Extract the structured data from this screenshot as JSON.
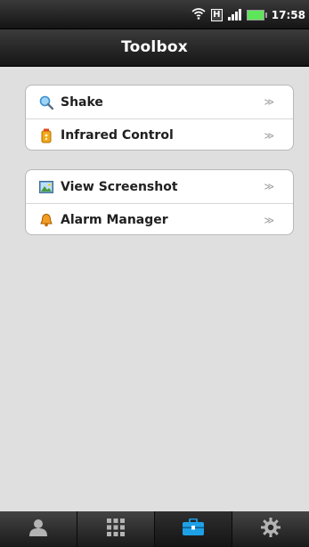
{
  "status_bar": {
    "network_badge": "H",
    "time": "17:58",
    "icons": [
      "wifi-icon",
      "network-h-icon",
      "signal-icon",
      "battery-icon"
    ]
  },
  "header": {
    "title": "Toolbox"
  },
  "groups": [
    {
      "items": [
        {
          "label": "Shake",
          "icon": "magnifier-icon",
          "arrow": "≫"
        },
        {
          "label": "Infrared Control",
          "icon": "infrared-icon",
          "arrow": "≫"
        }
      ]
    },
    {
      "items": [
        {
          "label": "View Screenshot",
          "icon": "picture-icon",
          "arrow": "≫"
        },
        {
          "label": "Alarm Manager",
          "icon": "alarm-bell-icon",
          "arrow": "≫"
        }
      ]
    }
  ],
  "tab_bar": {
    "tabs": [
      {
        "name": "contacts-tab",
        "icon": "person-icon",
        "active": false
      },
      {
        "name": "apps-tab",
        "icon": "grid-icon",
        "active": false
      },
      {
        "name": "toolbox-tab",
        "icon": "toolbox-icon",
        "active": true
      },
      {
        "name": "settings-tab",
        "icon": "gear-icon",
        "active": false
      }
    ]
  },
  "colors": {
    "background": "#dfdfdf",
    "active_tab_icon": "#1ea0e6",
    "inactive_tab_icon": "#b4b4b4"
  }
}
